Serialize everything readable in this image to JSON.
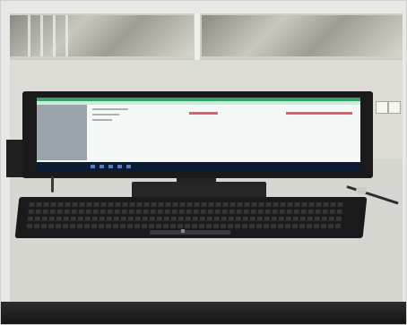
{
  "photo": {
    "subject": "",
    "colors": {
      "wall": "#dedcd6",
      "desk": "#d7d7d2",
      "monitor_bezel": "#1a1a1b",
      "screen_bg": "#f6f8f7",
      "screen_header": "#39a06a",
      "screen_highlight": "#e25f6a",
      "taskbar": "#0b1b33",
      "keyboard": "#1a1a1a"
    }
  }
}
